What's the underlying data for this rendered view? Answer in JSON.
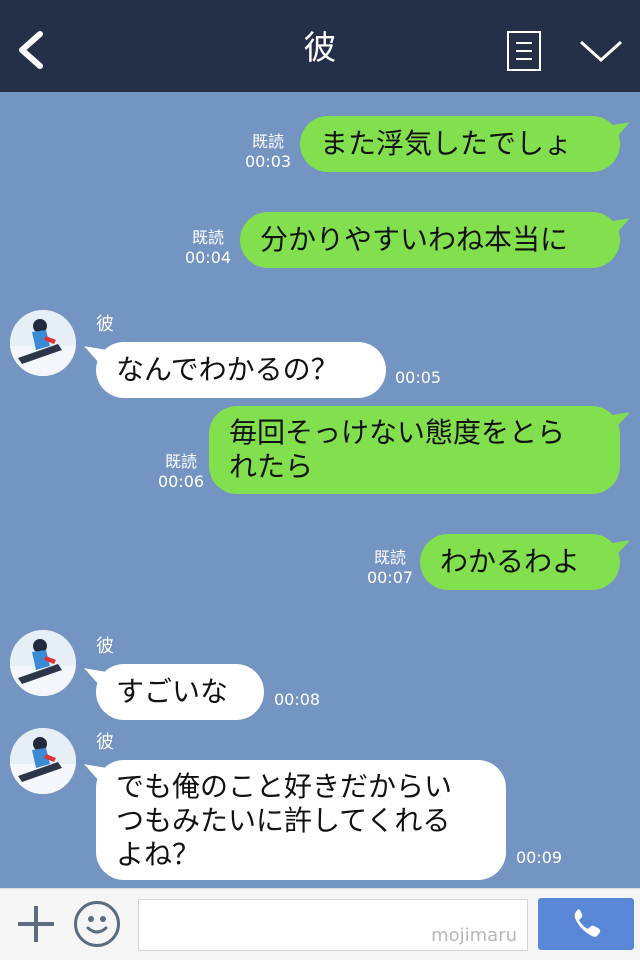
{
  "header": {
    "title": "彼",
    "back_icon": "chevron-left-icon",
    "menu_icon": "list-icon",
    "dropdown_icon": "chevron-down-icon"
  },
  "messages": [
    {
      "side": "out",
      "lines": [
        "また浮気したでしょ"
      ],
      "read": "既読",
      "time": "00:03"
    },
    {
      "side": "out",
      "lines": [
        "分かりやすいわね本当に"
      ],
      "read": "既読",
      "time": "00:04"
    },
    {
      "side": "in",
      "sender": "彼",
      "lines": [
        "なんでわかるの？"
      ],
      "time": "00:05"
    },
    {
      "side": "out",
      "lines": [
        "毎回そっけない態度をとら",
        "れたら"
      ],
      "read": "既読",
      "time": "00:06"
    },
    {
      "side": "out",
      "lines": [
        "わかるわよ"
      ],
      "read": "既読",
      "time": "00:07"
    },
    {
      "side": "in",
      "sender": "彼",
      "lines": [
        "すごいな"
      ],
      "time": "00:08"
    },
    {
      "side": "in",
      "sender": "彼",
      "lines": [
        "でも俺のこと好きだからい",
        "つもみたいに許してくれる",
        "よね？"
      ],
      "time": "00:09"
    }
  ],
  "footer": {
    "watermark": "mojimaru",
    "plus_icon": "plus-icon",
    "emoji_icon": "smiley-icon",
    "call_icon": "phone-icon"
  }
}
